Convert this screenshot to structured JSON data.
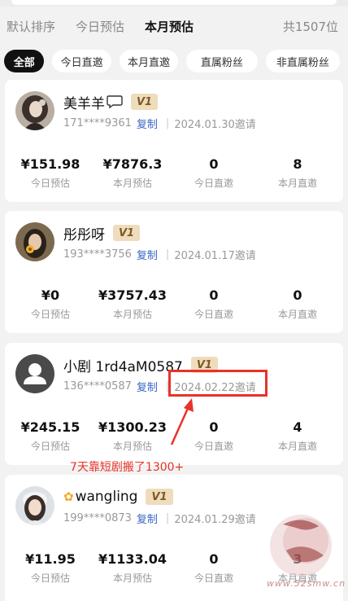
{
  "sort_tabs": [
    "默认排序",
    "今日预估",
    "本月预估"
  ],
  "active_sort": "本月预估",
  "total_count": "共1507位",
  "filter_chips": [
    "全部",
    "今日直邀",
    "本月直邀",
    "直属粉丝",
    "非直属粉丝"
  ],
  "active_filter": "全部",
  "stat_labels": [
    "今日预估",
    "本月预估",
    "今日直邀",
    "本月直邀"
  ],
  "copy_label": "复制",
  "level_badge": "V1",
  "users": [
    {
      "name": "美羊羊",
      "name_icon": "speech-bubble-icon",
      "phone": "171****9361",
      "invite_date": "2024.01.30邀请",
      "stats": [
        "¥151.98",
        "¥7876.3",
        "0",
        "8"
      ]
    },
    {
      "name": "彤彤呀",
      "phone": "193****3756",
      "invite_date": "2024.01.17邀请",
      "stats": [
        "¥0",
        "¥3757.43",
        "0",
        "0"
      ]
    },
    {
      "name": "小剧 1rd4aM0587",
      "phone": "136****0587",
      "invite_date": "2024.02.22邀请",
      "stats": [
        "¥245.15",
        "¥1300.23",
        "0",
        "4"
      ]
    },
    {
      "name": "wangling",
      "name_icon": "flower-icon",
      "phone": "199****0873",
      "invite_date": "2024.01.29邀请",
      "stats": [
        "¥11.95",
        "¥1133.04",
        "0",
        "3"
      ]
    }
  ],
  "annotation": "7天靠短剧搬了1300+",
  "colors": {
    "annotation_red": "#e8322a",
    "copy_blue": "#3a67c6",
    "badge_bg": "#efdcbc",
    "badge_text": "#7a5a26"
  },
  "watermark": {
    "glyphs": "吾爱",
    "url": "www.52smw.cn"
  }
}
